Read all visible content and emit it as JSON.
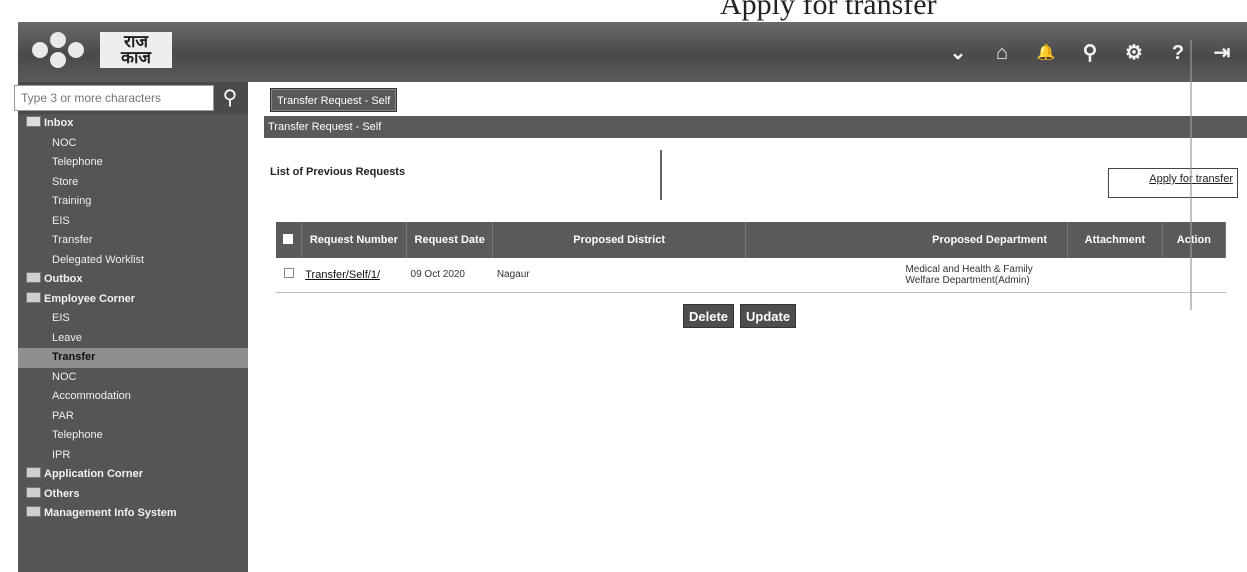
{
  "caption": "Apply for transfer",
  "header": {
    "logo_text": "राज काज",
    "icons": [
      "chevron-down-icon",
      "home-icon",
      "bell-icon",
      "search-icon",
      "gear-icon",
      "help-icon",
      "logout-icon"
    ],
    "icon_glyphs": [
      "⌄",
      "⌂",
      "🔔",
      "⚲",
      "⚙",
      "?",
      "⇥"
    ]
  },
  "sidebar": {
    "search_placeholder": "Type 3 or more characters",
    "items": [
      {
        "label": "Inbox",
        "type": "group"
      },
      {
        "label": "NOC",
        "type": "sub"
      },
      {
        "label": "Telephone",
        "type": "sub"
      },
      {
        "label": "Store",
        "type": "sub"
      },
      {
        "label": "Training",
        "type": "sub"
      },
      {
        "label": "EIS",
        "type": "sub"
      },
      {
        "label": "Transfer",
        "type": "sub"
      },
      {
        "label": "Delegated Worklist",
        "type": "sub"
      },
      {
        "label": "Outbox",
        "type": "group"
      },
      {
        "label": "Employee Corner",
        "type": "group"
      },
      {
        "label": "EIS",
        "type": "sub"
      },
      {
        "label": "Leave",
        "type": "sub"
      },
      {
        "label": "Transfer",
        "type": "sub",
        "active": true
      },
      {
        "label": "NOC",
        "type": "sub"
      },
      {
        "label": "Accommodation",
        "type": "sub"
      },
      {
        "label": "PAR",
        "type": "sub"
      },
      {
        "label": "Telephone",
        "type": "sub"
      },
      {
        "label": "IPR",
        "type": "sub"
      },
      {
        "label": "Application Corner",
        "type": "group"
      },
      {
        "label": "Others",
        "type": "group"
      },
      {
        "label": "Management Info System",
        "type": "group"
      }
    ]
  },
  "main": {
    "tab_label": "Transfer Request - Self",
    "panel_title": "Transfer Request - Self",
    "list_title": "List of Previous Requests",
    "apply_link": "Apply for transfer",
    "table": {
      "headers": [
        "Request Number",
        "Request Date",
        "Proposed District",
        "Proposed Department",
        "Attachment",
        "Action"
      ],
      "rows": [
        {
          "number": "Transfer/Self/1/",
          "date": "09 Oct 2020",
          "district": "Nagaur",
          "department": "Medical and Health & Family Welfare Department(Admin)",
          "attachment": "",
          "action": ""
        }
      ]
    },
    "buttons": {
      "delete": "Delete",
      "update": "Update"
    }
  }
}
